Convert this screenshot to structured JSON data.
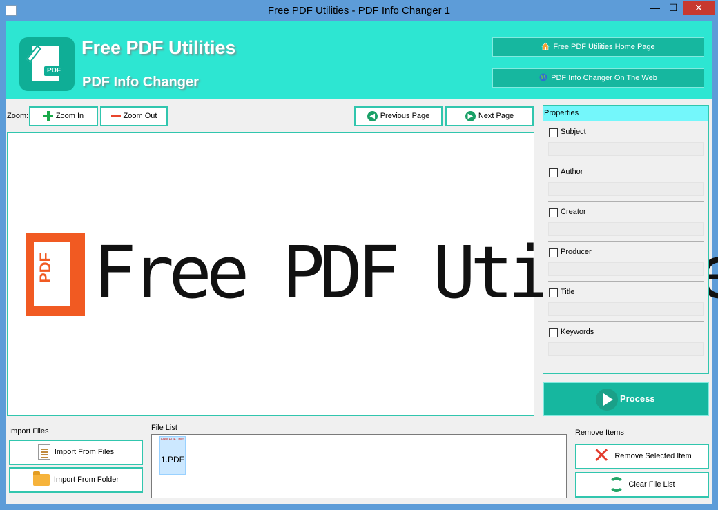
{
  "window": {
    "title": "Free PDF Utilities - PDF Info Changer 1",
    "min_glyph": "—",
    "max_glyph": "☐",
    "close_glyph": "✕"
  },
  "header": {
    "app_title": "Free PDF Utilities",
    "app_subtitle": "PDF Info Changer",
    "logo_text": "PDF",
    "home_link": "Free PDF Utilities Home Page",
    "web_link": "PDF Info Changer On The Web",
    "accent_color": "#2de6d2",
    "button_color": "#16b79f"
  },
  "toolbar": {
    "zoom_label": "Zoom:",
    "zoom_in": "Zoom In",
    "zoom_out": "Zoom Out",
    "previous_page": "Previous Page",
    "next_page": "Next Page"
  },
  "preview": {
    "logo_text": "PDF",
    "text": "Free PDF Utilities"
  },
  "properties": {
    "header": "Properties",
    "fields": [
      {
        "label": "Subject",
        "checked": false,
        "value": ""
      },
      {
        "label": "Author",
        "checked": false,
        "value": ""
      },
      {
        "label": "Creator",
        "checked": false,
        "value": ""
      },
      {
        "label": "Producer",
        "checked": false,
        "value": ""
      },
      {
        "label": "Title",
        "checked": false,
        "value": ""
      },
      {
        "label": "Keywords",
        "checked": false,
        "value": ""
      }
    ]
  },
  "process": {
    "label": "Process"
  },
  "import": {
    "label": "Import Files",
    "from_files": "Import From Files",
    "from_folder": "Import From Folder"
  },
  "file_list": {
    "label": "File List",
    "items": [
      {
        "name": "1.PDF",
        "thumb_text": "Free PDF Utilities"
      }
    ]
  },
  "remove": {
    "label": "Remove Items",
    "remove_selected": "Remove Selected Item",
    "clear_list": "Clear File List"
  },
  "icons": {
    "home": "home-icon",
    "web": "globe-icon",
    "zoom_in": "plus-icon",
    "zoom_out": "minus-icon",
    "prev": "arrow-left-circle-icon",
    "next": "arrow-right-circle-icon",
    "process": "play-icon",
    "import_files": "document-list-icon",
    "import_folder": "folder-icon",
    "remove": "red-x-icon",
    "clear": "refresh-icon"
  }
}
